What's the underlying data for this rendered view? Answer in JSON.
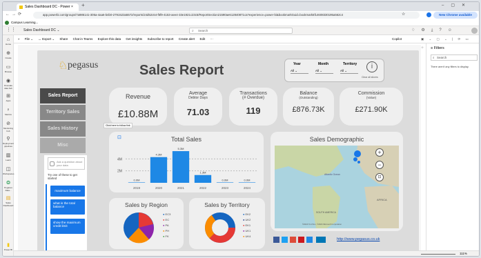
{
  "browser": {
    "tab_title": "Sales Dashboard DC - Power ×",
    "url": "app.powerbi.com/groups/7a986141-305a-4aa6-b4b0-2791523a5572/reports/24d52c64-f5f9-4153-aee4-33e1921c23c5/ReportSection21590ae612840871ca?experience=power-bi&bookmarkGuid=bookmark5f14608330195a562c4",
    "bookmark": "Campus Learning...",
    "new_chrome": "New Chrome available"
  },
  "pbi": {
    "breadcrumb": "Sales Dashboard DC ⌄",
    "search": "Search",
    "copilot": "Copilot"
  },
  "rail": [
    "Home",
    "Create",
    "Browse",
    "OneLake data hub",
    "Apps",
    "Metrics",
    "Monitoring hub",
    "Deployment pipelines",
    "Learn",
    "Workspaces",
    "Pegasus Data...",
    "Sales Dashboard"
  ],
  "rail_bottom": "Power BI",
  "actions": [
    "File ⌄",
    "↔ Export ⌄",
    "Share",
    "Chat in Teams",
    "Explore this data",
    "Get insights",
    "Subscribe to report",
    "Create alert",
    "Edit",
    "···"
  ],
  "report": {
    "title": "Sales Report",
    "logo": "pegasus",
    "slicers": {
      "year": "Year",
      "month": "Month",
      "territory": "Territory",
      "all": "All",
      "clear": "Clear all slicers"
    },
    "nav": [
      "Sales Report",
      "Territory Sales",
      "Sales History",
      "Misc"
    ],
    "kpis": {
      "revenue": {
        "label": "Revenue",
        "value": "£10.88M"
      },
      "debtor": {
        "label": "Average",
        "sub": "Debtor Days",
        "value": "71.03"
      },
      "trans": {
        "label": "Transactions",
        "sub": "(# Overdue)",
        "value": "119"
      },
      "balance": {
        "label": "Balance",
        "sub": "(Outstanding)",
        "value": "£876.73K"
      },
      "commission": {
        "label": "Commission",
        "sub": "(Value)",
        "value": "£271.90K"
      }
    },
    "tooltip": "Click here to follow link",
    "total_sales": "Total Sales",
    "sales_demo": "Sales Demographic",
    "by_region": "Sales by Region",
    "by_territory": "Sales by Territory",
    "region_legend": [
      "EC3",
      "EC",
      "PA",
      "PH",
      "FK"
    ],
    "territory_legend": [
      "EK2",
      "UK2",
      "EK1",
      "UK1",
      "UK4"
    ],
    "website": "http://www.pegasus.co.uk",
    "map_labels": {
      "atlantic": "Atlantic Ocean",
      "africa": "AFRICA",
      "sa": "SOUTH AMERICA",
      "copy": "©2024 TomTom, ©2024 Microsoft Corporation"
    },
    "chat": {
      "placeholder": "Ask a question about your data",
      "hint": "Try one of these to get started",
      "q1": "maximum balance",
      "q2": "what is the total balance",
      "q3": "show the maximum credit limit"
    }
  },
  "filters": {
    "title": "Filters",
    "search": "Search",
    "empty": "There aren't any filters to display."
  },
  "status": {
    "zoom": "111%"
  },
  "colors": {
    "bar": "#1e88e5",
    "accent": "#e6a817",
    "nav": "#5b5b5b"
  },
  "chart_data": {
    "type": "bar",
    "title": "Total Sales",
    "categories": [
      "2019",
      "2020",
      "2021",
      "2022",
      "2023",
      "2024"
    ],
    "values": [
      0.0,
      4.3,
      5.3,
      1.3,
      0.0,
      0.0
    ],
    "data_labels": [
      "0.0M",
      "4.3M",
      "5.3M",
      "1.3M",
      "0.0M",
      "0.0M"
    ],
    "ytick_labels": [
      "4M",
      "2M"
    ],
    "ylim": [
      0,
      6
    ],
    "grid": true
  }
}
